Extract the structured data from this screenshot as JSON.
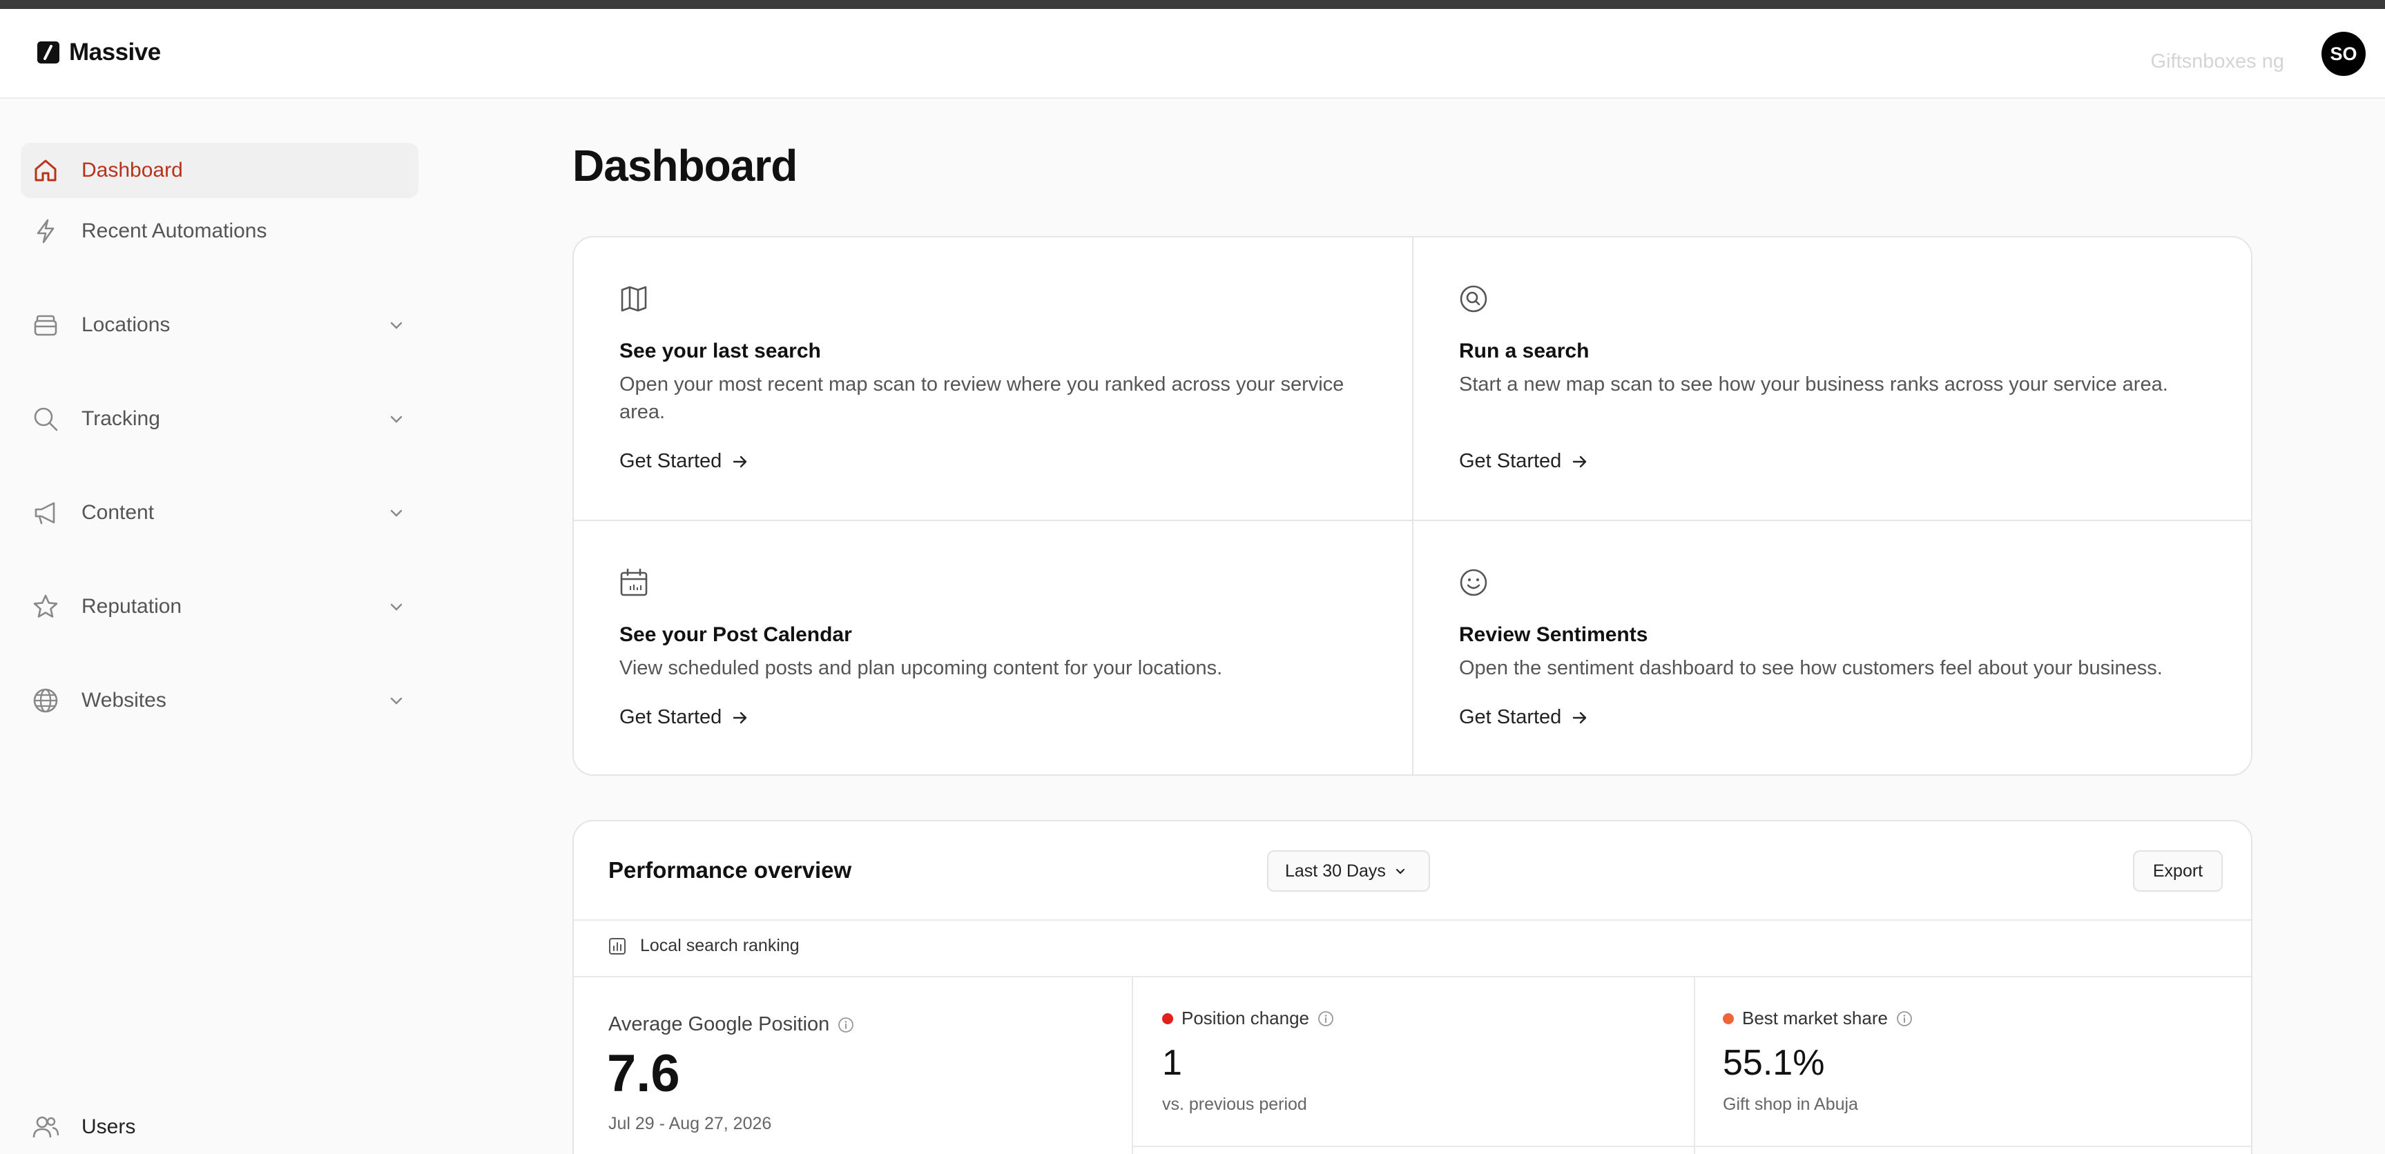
{
  "header": {
    "brand": "Massive",
    "workspace": "Giftsnboxes ng",
    "avatar_initials": "SO"
  },
  "sidebar": {
    "items": [
      {
        "label": "Dashboard",
        "icon": "home-icon",
        "active": true
      },
      {
        "label": "Recent Automations",
        "icon": "lightning-icon"
      },
      {
        "label": "Locations",
        "icon": "store-icon",
        "expandable": true
      },
      {
        "label": "Tracking",
        "icon": "search-icon",
        "expandable": true
      },
      {
        "label": "Content",
        "icon": "megaphone-icon",
        "expandable": true
      },
      {
        "label": "Reputation",
        "icon": "star-icon",
        "expandable": true
      },
      {
        "label": "Websites",
        "icon": "globe-icon",
        "expandable": true
      }
    ],
    "footer_item": {
      "label": "Users",
      "icon": "users-icon"
    }
  },
  "main": {
    "title": "Dashboard",
    "cards": [
      {
        "icon": "map-icon",
        "title": "See your last search",
        "desc": "Open your most recent map scan to review where you ranked across your service area.",
        "cta": "Get Started"
      },
      {
        "icon": "search-target-icon",
        "title": "Run a search",
        "desc": "Start a new map scan to see how your business ranks across your service area.",
        "cta": "Get Started"
      },
      {
        "icon": "calendar-icon",
        "title": "See your Post Calendar",
        "desc": "View scheduled posts and plan upcoming content for your locations.",
        "cta": "Get Started"
      },
      {
        "icon": "smiley-icon",
        "title": "Review Sentiments",
        "desc": "Open the sentiment dashboard to see how customers feel about your business.",
        "cta": "Get Started"
      }
    ],
    "performance": {
      "title": "Performance overview",
      "range_label": "Last 30 Days",
      "export_label": "Export",
      "section_label": "Local search ranking",
      "avg_position": {
        "label": "Average Google Position",
        "value": "7.6",
        "sub": "Jul 29 - Aug 27, 2026"
      },
      "position_change": {
        "label": "Position change",
        "value": "1",
        "sub": "vs. previous period",
        "dot_color": "#e0201b"
      },
      "market_share": {
        "label": "Best market share",
        "value": "55.1%",
        "sub": "Gift shop in Abuja",
        "dot_color": "#f0643c"
      }
    }
  },
  "colors": {
    "accent": "#b8321a",
    "brand": "#111111"
  }
}
